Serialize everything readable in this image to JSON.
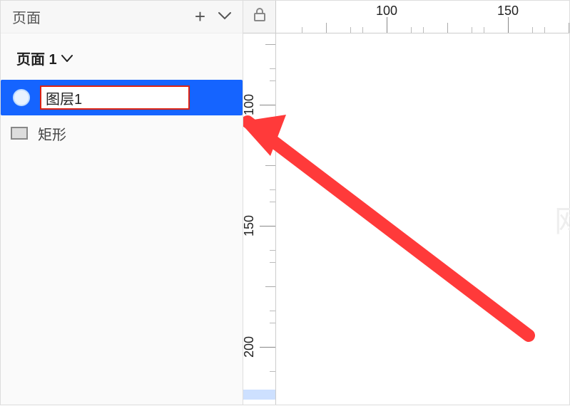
{
  "sidebar": {
    "panel_title": "页面",
    "add_icon_label": "+",
    "page_name": "页面 1",
    "layers": [
      {
        "name": "图层1",
        "icon": "circle",
        "selected": true,
        "editing": true
      },
      {
        "name": "矩形",
        "icon": "rect",
        "selected": false,
        "editing": false
      }
    ]
  },
  "ruler": {
    "horizontal_labels": [
      100,
      150
    ],
    "vertical_labels": [
      100,
      150,
      200
    ],
    "lock_icon": "lock"
  },
  "watermark": "网"
}
